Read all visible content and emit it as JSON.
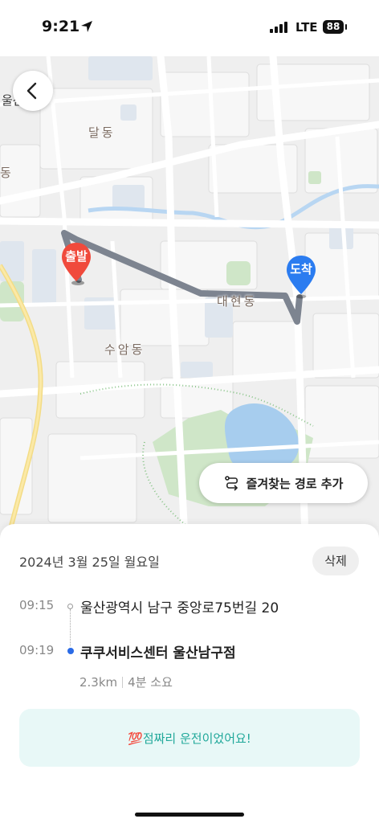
{
  "status_bar": {
    "time": "9:21",
    "network": "LTE",
    "battery": "88"
  },
  "map": {
    "labels": {
      "city_hall": "울산시청",
      "dal_dong": "달동",
      "dong_left": "동",
      "daehyeon_dong": "대현동",
      "suam_dong": "수암동"
    },
    "start_pin": "출발",
    "end_pin": "도착",
    "colors": {
      "start_pin": "#f04a3c",
      "end_pin": "#2b7cf0",
      "route": "#7d8490"
    }
  },
  "favorite_route_button": "즐겨찾는 경로 추가",
  "trip": {
    "date": "2024년 3월 25일 월요일",
    "delete_label": "삭제",
    "start": {
      "time": "09:15",
      "address": "울산광역시 남구 중앙로75번길 20"
    },
    "end": {
      "time": "09:19",
      "place": "쿠쿠서비스센터 울산남구점"
    },
    "distance": "2.3km",
    "duration": "4분 소요",
    "score_message": "💯점짜리 운전이었어요!"
  }
}
